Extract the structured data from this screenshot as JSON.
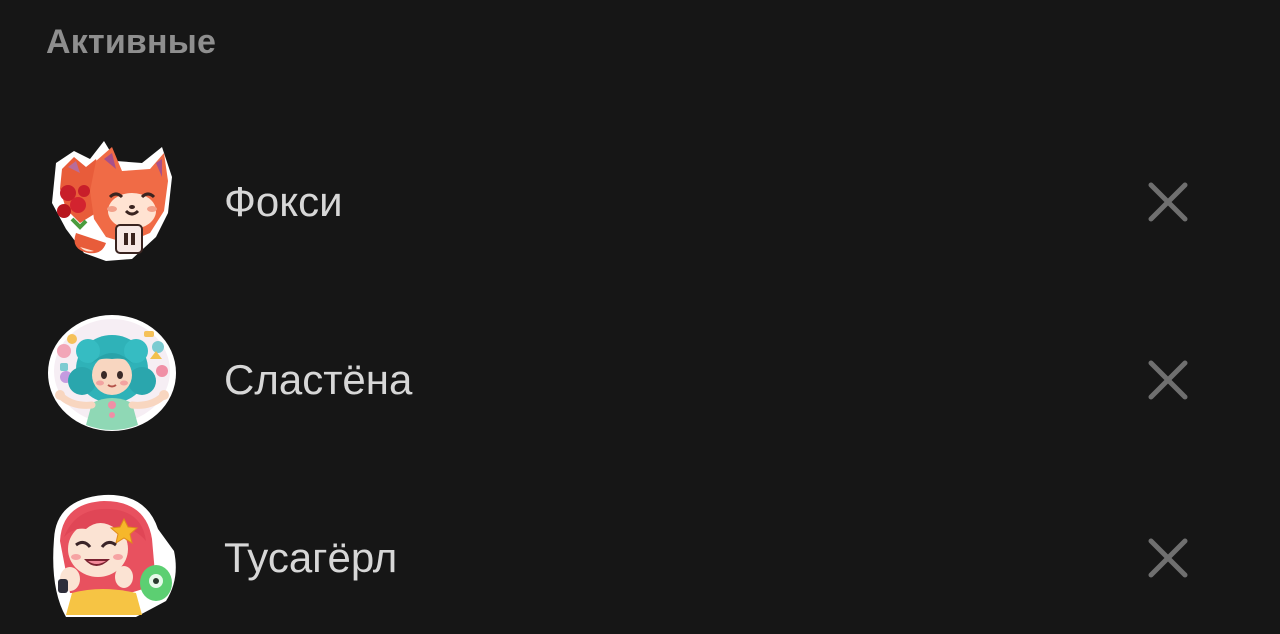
{
  "section": {
    "title": "Активные"
  },
  "packs": [
    {
      "name": "Фокси",
      "thumbnail_icon": "foxy-sticker-icon",
      "remove_icon": "close-icon"
    },
    {
      "name": "Сластёна",
      "thumbnail_icon": "sweet-tooth-sticker-icon",
      "remove_icon": "close-icon"
    },
    {
      "name": "Тусагёрл",
      "thumbnail_icon": "party-girl-sticker-icon",
      "remove_icon": "close-icon"
    }
  ],
  "colors": {
    "background": "#161616",
    "header_text": "#8e8e8e",
    "item_text": "#d7d7d7",
    "close_icon": "#6f6f6f"
  }
}
